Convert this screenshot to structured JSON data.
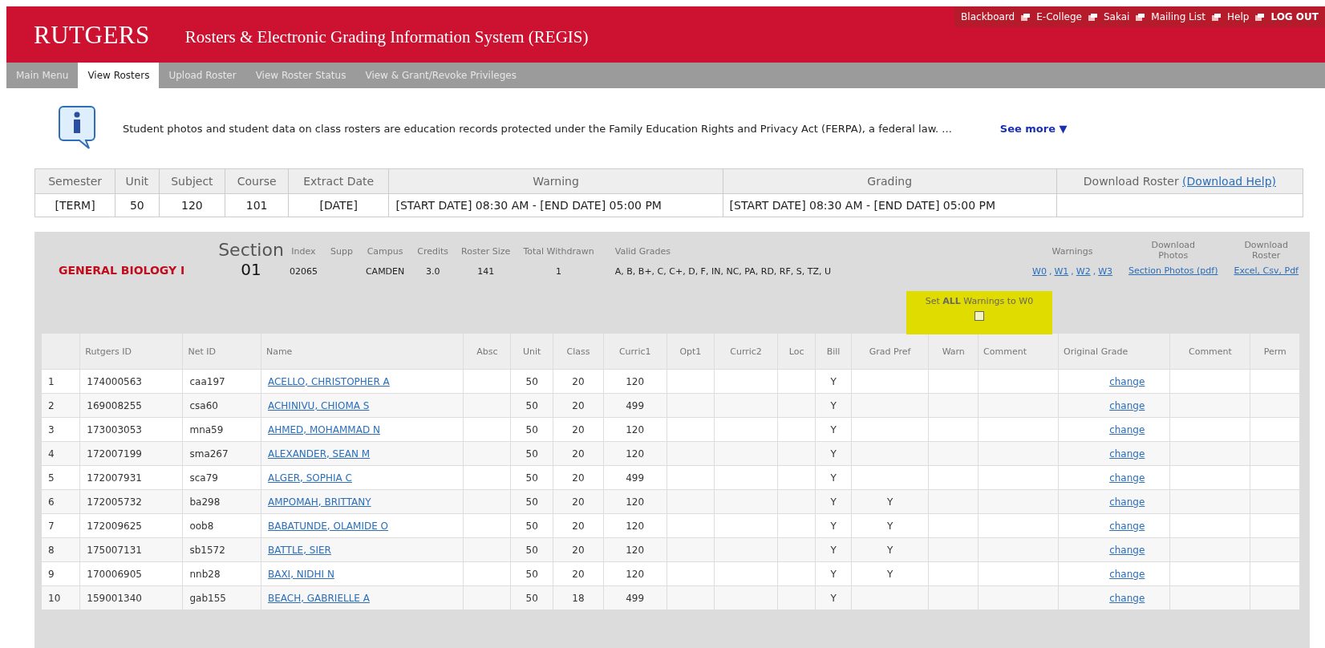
{
  "header": {
    "logo": "RUTGERS",
    "title": "Rosters & Electronic Grading Information System (REGIS)",
    "links": [
      {
        "label": "Blackboard",
        "external": true
      },
      {
        "label": "E-College",
        "external": true
      },
      {
        "label": "Sakai",
        "external": true
      },
      {
        "label": "Mailing List",
        "external": true
      },
      {
        "label": "Help",
        "external": true
      },
      {
        "label": "LOG OUT",
        "external": false
      }
    ]
  },
  "tabs": [
    {
      "label": "Main Menu",
      "selected": false
    },
    {
      "label": "View Rosters",
      "selected": true
    },
    {
      "label": "Upload Roster",
      "selected": false
    },
    {
      "label": "View Roster Status",
      "selected": false
    },
    {
      "label": "View & Grant/Revoke Privileges",
      "selected": false
    }
  ],
  "notice": {
    "text": "Student photos and student data on class rosters are education records protected under the Family Education Rights and Privacy Act (FERPA), a federal law. ...",
    "link": "See more ▼"
  },
  "course_table": {
    "columns": [
      "Semester",
      "Unit",
      "Subject",
      "Course",
      "Extract Date",
      "Warning",
      "Grading",
      "Download Roster"
    ],
    "help_link": "(Download Help)",
    "values": [
      "[TERM]",
      "50",
      "120",
      "101",
      "[DATE]",
      "[START DATE] 08:30 AM - [END DATE]  05:00 PM",
      "[START DATE] 08:30 AM - [END DATE] 05:00 PM"
    ]
  },
  "section": {
    "course_title": "GENERAL BIOLOGY I",
    "section_label": "Section",
    "section_number": "01",
    "fields": [
      {
        "label": "Index",
        "value": "02065"
      },
      {
        "label": "Supp"
      },
      {
        "label": "Campus",
        "value": "CAMDEN"
      },
      {
        "label": "Credits",
        "value": "3.0"
      },
      {
        "label": "Roster Size",
        "value": "141"
      },
      {
        "label": "Total Withdrawn",
        "value": "1"
      },
      {
        "label": "Valid Grades",
        "value": "A, B, B+, C, C+, D, F, IN, NC, PA, RD, RF, S, TZ, U"
      }
    ],
    "warnings": {
      "label": "Warnings",
      "links": [
        "W0",
        "W1",
        "W2",
        "W3"
      ],
      "separator": ","
    },
    "download_photos": {
      "label": "Download Photos",
      "link": "Section Photos (pdf)"
    },
    "download_roster": {
      "label": "Download Roster",
      "link": "Excel, Csv, Pdf"
    },
    "set_all": {
      "label": "Set **ALL** Warnings to W0",
      "checked": false,
      "highlighted": true
    }
  },
  "roster": {
    "columns": [
      "Rutgers ID",
      "Net ID",
      "Name",
      "Absc",
      "Unit",
      "Class",
      "Curric1",
      "Opt1",
      "Curric2",
      "Loc",
      "Bill",
      "Grad Pref",
      "Warn",
      "Comment",
      "Original Grade",
      "Comment",
      "Perm"
    ],
    "rows": [
      {
        "number": "1",
        "rutgers_id": "174000563",
        "net_id": "caa197",
        "name": "ACELLO, CHRISTOPHER A",
        "unit": "50",
        "class": "20",
        "curric1": "120",
        "bill": "Y",
        "action": "change"
      },
      {
        "number": "2",
        "rutgers_id": "169008255",
        "net_id": "csa60",
        "name": "ACHINIVU, CHIOMA S",
        "unit": "50",
        "class": "20",
        "curric1": "499",
        "bill": "Y",
        "action": "change"
      },
      {
        "number": "3",
        "rutgers_id": "173003053",
        "net_id": "mna59",
        "name": "AHMED, MOHAMMAD N",
        "unit": "50",
        "class": "20",
        "curric1": "120",
        "bill": "Y",
        "action": "change"
      },
      {
        "number": "4",
        "rutgers_id": "172007199",
        "net_id": "sma267",
        "name": "ALEXANDER, SEAN M",
        "unit": "50",
        "class": "20",
        "curric1": "120",
        "bill": "Y",
        "action": "change"
      },
      {
        "number": "5",
        "rutgers_id": "172007931",
        "net_id": "sca79",
        "name": "ALGER, SOPHIA C",
        "unit": "50",
        "class": "20",
        "curric1": "499",
        "bill": "Y",
        "action": "change"
      },
      {
        "number": "6",
        "rutgers_id": "172005732",
        "net_id": "ba298",
        "name": "AMPOMAH, BRITTANY",
        "unit": "50",
        "class": "20",
        "curric1": "120",
        "bill": "Y",
        "grad_pref": "Y",
        "action": "change"
      },
      {
        "number": "7",
        "rutgers_id": "172009625",
        "net_id": "oob8",
        "name": "BABATUNDE, OLAMIDE O",
        "unit": "50",
        "class": "20",
        "curric1": "120",
        "bill": "Y",
        "grad_pref": "Y",
        "action": "change"
      },
      {
        "number": "8",
        "rutgers_id": "175007131",
        "net_id": "sb1572",
        "name": "BATTLE, SIER",
        "unit": "50",
        "class": "20",
        "curric1": "120",
        "bill": "Y",
        "grad_pref": "Y",
        "action": "change"
      },
      {
        "number": "9",
        "rutgers_id": "170006905",
        "net_id": "nnb28",
        "name": "BAXI, NIDHI N",
        "unit": "50",
        "class": "20",
        "curric1": "120",
        "bill": "Y",
        "grad_pref": "Y",
        "action": "change"
      },
      {
        "number": "10",
        "rutgers_id": "159001340",
        "net_id": "gab155",
        "name": "BEACH, GABRIELLE A",
        "unit": "50",
        "class": "18",
        "curric1": "499",
        "bill": "Y",
        "action": "change"
      }
    ]
  }
}
